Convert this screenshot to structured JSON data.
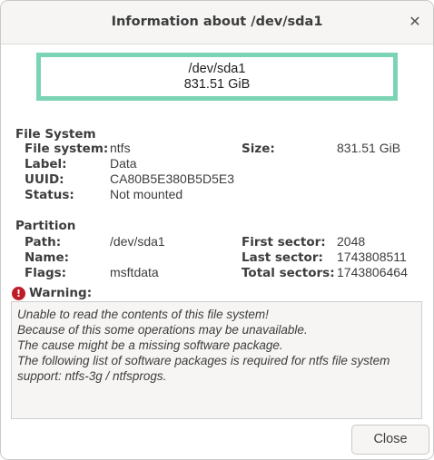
{
  "window": {
    "title": "Information about /dev/sda1"
  },
  "graphic": {
    "path": "/dev/sda1",
    "size": "831.51 GiB",
    "color": "#7bd4b4"
  },
  "file_system": {
    "heading": "File System",
    "fs_label": "File system:",
    "fs_value": "ntfs",
    "size_label": "Size:",
    "size_value": "831.51 GiB",
    "label_label": "Label:",
    "label_value": "Data",
    "uuid_label": "UUID:",
    "uuid_value": "CA80B5E380B5D5E3",
    "status_label": "Status:",
    "status_value": "Not mounted"
  },
  "partition": {
    "heading": "Partition",
    "path_label": "Path:",
    "path_value": "/dev/sda1",
    "name_label": "Name:",
    "name_value": "",
    "flags_label": "Flags:",
    "flags_value": "msftdata",
    "first_sector_label": "First sector:",
    "first_sector_value": "2048",
    "last_sector_label": "Last sector:",
    "last_sector_value": "1743808511",
    "total_sectors_label": "Total sectors:",
    "total_sectors_value": "1743806464"
  },
  "warning": {
    "label": "Warning:",
    "icon": "dialog-error-icon",
    "lines": [
      "Unable to read the contents of this file system!",
      "Because of this some operations may be unavailable.",
      "The cause might be a missing software package.",
      "The following list of software packages is required for ntfs file system",
      "support:  ntfs-3g / ntfsprogs."
    ]
  },
  "buttons": {
    "close": "Close"
  }
}
